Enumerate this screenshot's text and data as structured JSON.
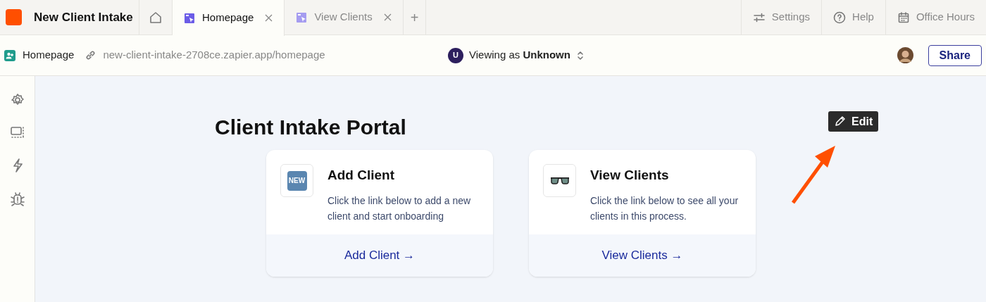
{
  "app": {
    "title": "New Client Intake"
  },
  "tabs": [
    {
      "label": "Homepage",
      "selected": true,
      "closable": true
    },
    {
      "label": "View Clients",
      "selected": false,
      "closable": true
    }
  ],
  "add_tab": "+",
  "top_actions": [
    {
      "kind": "settings",
      "label": "Settings"
    },
    {
      "kind": "help",
      "label": "Help"
    },
    {
      "kind": "calendar",
      "label": "Office Hours"
    }
  ],
  "page_bar": {
    "page": "Homepage",
    "url": "new-client-intake-2708ce.zapier.app/homepage",
    "viewer_initial": "U",
    "viewing_as": "Viewing as **Unknown**",
    "share": "Share"
  },
  "sidebar": [
    {
      "kind": "settings"
    },
    {
      "kind": "layout"
    },
    {
      "kind": "bolt"
    },
    {
      "kind": "bug"
    }
  ],
  "page": {
    "title": "Client Intake Portal",
    "edit": "Edit",
    "cards": [
      {
        "kind": "new",
        "badge": "NEW",
        "title": "Add Client",
        "text": "Click the link below to add a new client and start onboarding",
        "link": "Add Client →"
      },
      {
        "kind": "glasses",
        "title": "View Clients",
        "text": "Click the link below to see all your clients in this process.",
        "link": "View Clients →"
      }
    ]
  }
}
